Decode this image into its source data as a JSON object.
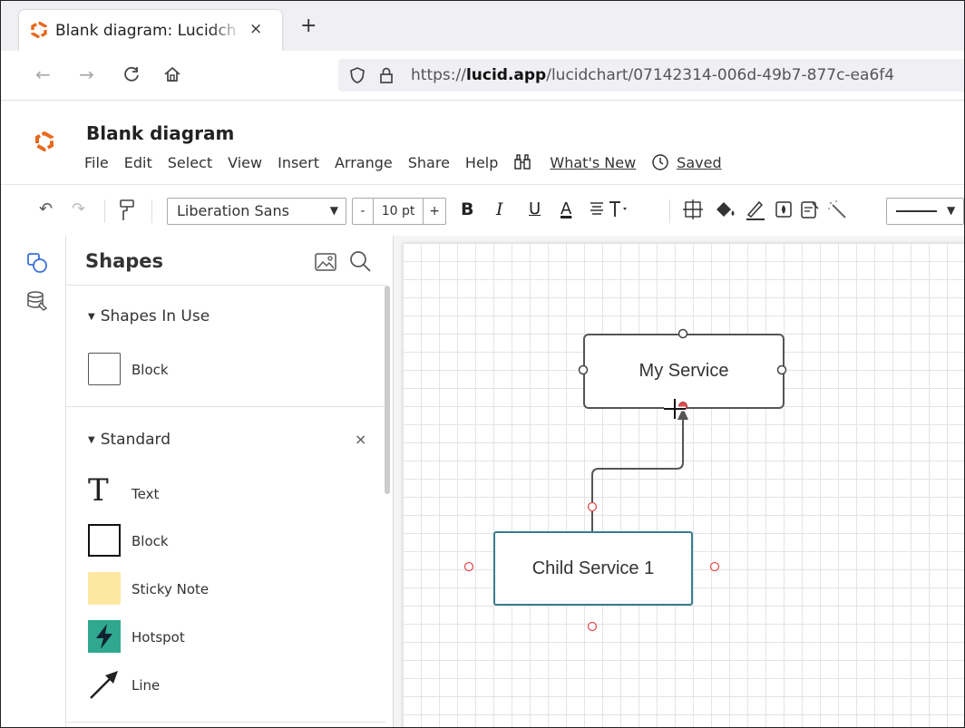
{
  "browser": {
    "tab_title": "Blank diagram: Lucidch",
    "close_glyph": "×",
    "newtab_glyph": "+",
    "url_prefix": "https://",
    "url_domain": "lucid.app",
    "url_path": "/lucidchart/07142314-006d-49b7-877c-ea6f4"
  },
  "document": {
    "title": "Blank diagram",
    "menus": [
      "File",
      "Edit",
      "Select",
      "View",
      "Insert",
      "Arrange",
      "Share",
      "Help"
    ],
    "whats_new": "What's New",
    "saved": "Saved"
  },
  "toolbar": {
    "font_name": "Liberation Sans",
    "font_size": "10 pt",
    "minus": "-",
    "plus": "+",
    "bold": "B",
    "italic": "I",
    "underline": "U",
    "font_color": "A"
  },
  "shapes_panel": {
    "title": "Shapes",
    "in_use_title": "Shapes In Use",
    "in_use_items": [
      "Block"
    ],
    "standard_title": "Standard",
    "standard_close": "×",
    "standard_items": [
      "Text",
      "Block",
      "Sticky Note",
      "Hotspot",
      "Line"
    ]
  },
  "canvas": {
    "nodes": [
      "My Service",
      "Child Service 1"
    ]
  },
  "colors": {
    "brand_orange": "#e8691d",
    "child_border": "#3b7a8f",
    "connector_red": "#e05050",
    "hotspot": "#2fa88f",
    "sticky": "#fde8a2"
  }
}
